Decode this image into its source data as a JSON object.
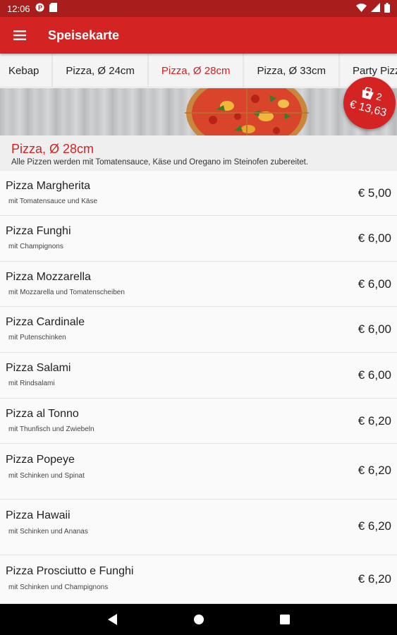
{
  "status_bar": {
    "time": "12:06",
    "icons_left": [
      "app-notification-icon",
      "sd-card-icon"
    ],
    "icons_right": [
      "wifi-icon",
      "signal-icon",
      "battery-icon"
    ]
  },
  "app_bar": {
    "title": "Speisekarte",
    "menu_icon": "hamburger-icon"
  },
  "tabs": [
    {
      "label": "Kebap"
    },
    {
      "label": "Pizza, Ø 24cm"
    },
    {
      "label": "Pizza, Ø 28cm",
      "active": true
    },
    {
      "label": "Pizza, Ø 33cm"
    },
    {
      "label": "Party Pizza"
    }
  ],
  "cart": {
    "count": "2",
    "total": "€ 13,63",
    "icon": "shopping-bag-icon"
  },
  "section": {
    "title": "Pizza, Ø 28cm",
    "description": "Alle Pizzen werden mit Tomatensauce, Käse und Oregano im Steinofen zubereitet."
  },
  "items": [
    {
      "name": "Pizza Margherita",
      "desc": "mit Tomatensauce und Käse",
      "price": "€ 5,00"
    },
    {
      "name": "Pizza Funghi",
      "desc": "mit Champignons",
      "price": "€ 6,00"
    },
    {
      "name": "Pizza Mozzarella",
      "desc": "mit Mozzarella und Tomatenscheiben",
      "price": "€ 6,00"
    },
    {
      "name": "Pizza Cardinale",
      "desc": "mit Putenschinken",
      "price": "€ 6,00"
    },
    {
      "name": "Pizza Salami",
      "desc": "mit Rindsalami",
      "price": "€ 6,00"
    },
    {
      "name": "Pizza al Tonno",
      "desc": "mit Thunfisch und Zwiebeln",
      "price": "€ 6,20"
    },
    {
      "name": "Pizza Popeye",
      "desc": "mit Schinken und Spinat",
      "price": "€ 6,20"
    },
    {
      "name": "Pizza Hawaii",
      "desc": "mit Schinken und Ananas",
      "price": "€ 6,20"
    },
    {
      "name": "Pizza Prosciutto e Funghi",
      "desc": "mit Schinken und Champignons",
      "price": "€ 6,20"
    }
  ],
  "nav_bar": {
    "buttons": [
      "back-icon",
      "home-icon",
      "recents-icon"
    ]
  },
  "colors": {
    "primary": "#d32323",
    "status_bar": "#a91d1d"
  }
}
